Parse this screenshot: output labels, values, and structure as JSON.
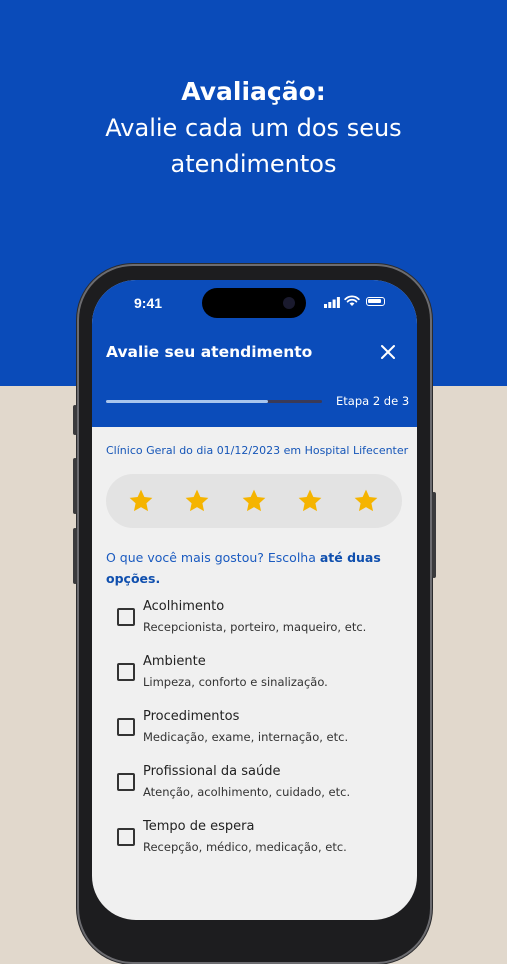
{
  "headline": {
    "title": "Avaliação:",
    "subtitle_line1": "Avalie cada um dos seus",
    "subtitle_line2": "atendimentos"
  },
  "status_bar": {
    "time": "9:41"
  },
  "app_bar": {
    "title": "Avalie seu atendimento",
    "step_label": "Etapa 2 de 3",
    "progress_fraction": 0.75
  },
  "appointment": {
    "description": "Clínico Geral do dia 01/12/2023 em Hospital Lifecenter"
  },
  "rating": {
    "value": 5,
    "max": 5,
    "star_color": "#f5b400"
  },
  "question": {
    "prefix": "O que você mais gostou? Escolha ",
    "emphasis": "até duas opções."
  },
  "options": [
    {
      "label": "Acolhimento",
      "description": "Recepcionista, porteiro, maqueiro, etc.",
      "checked": false
    },
    {
      "label": "Ambiente",
      "description": "Limpeza, conforto e sinalização.",
      "checked": false
    },
    {
      "label": "Procedimentos",
      "description": "Medicação, exame, internação, etc.",
      "checked": false
    },
    {
      "label": "Profissional da saúde",
      "description": "Atenção, acolhimento, cuidado, etc.",
      "checked": false
    },
    {
      "label": "Tempo de espera",
      "description": "Recepção, médico, medicação, etc.",
      "checked": false
    }
  ],
  "colors": {
    "brand_blue": "#0a4bb9",
    "background_beige": "#e1d8cc",
    "text_blue": "#1656b8"
  }
}
